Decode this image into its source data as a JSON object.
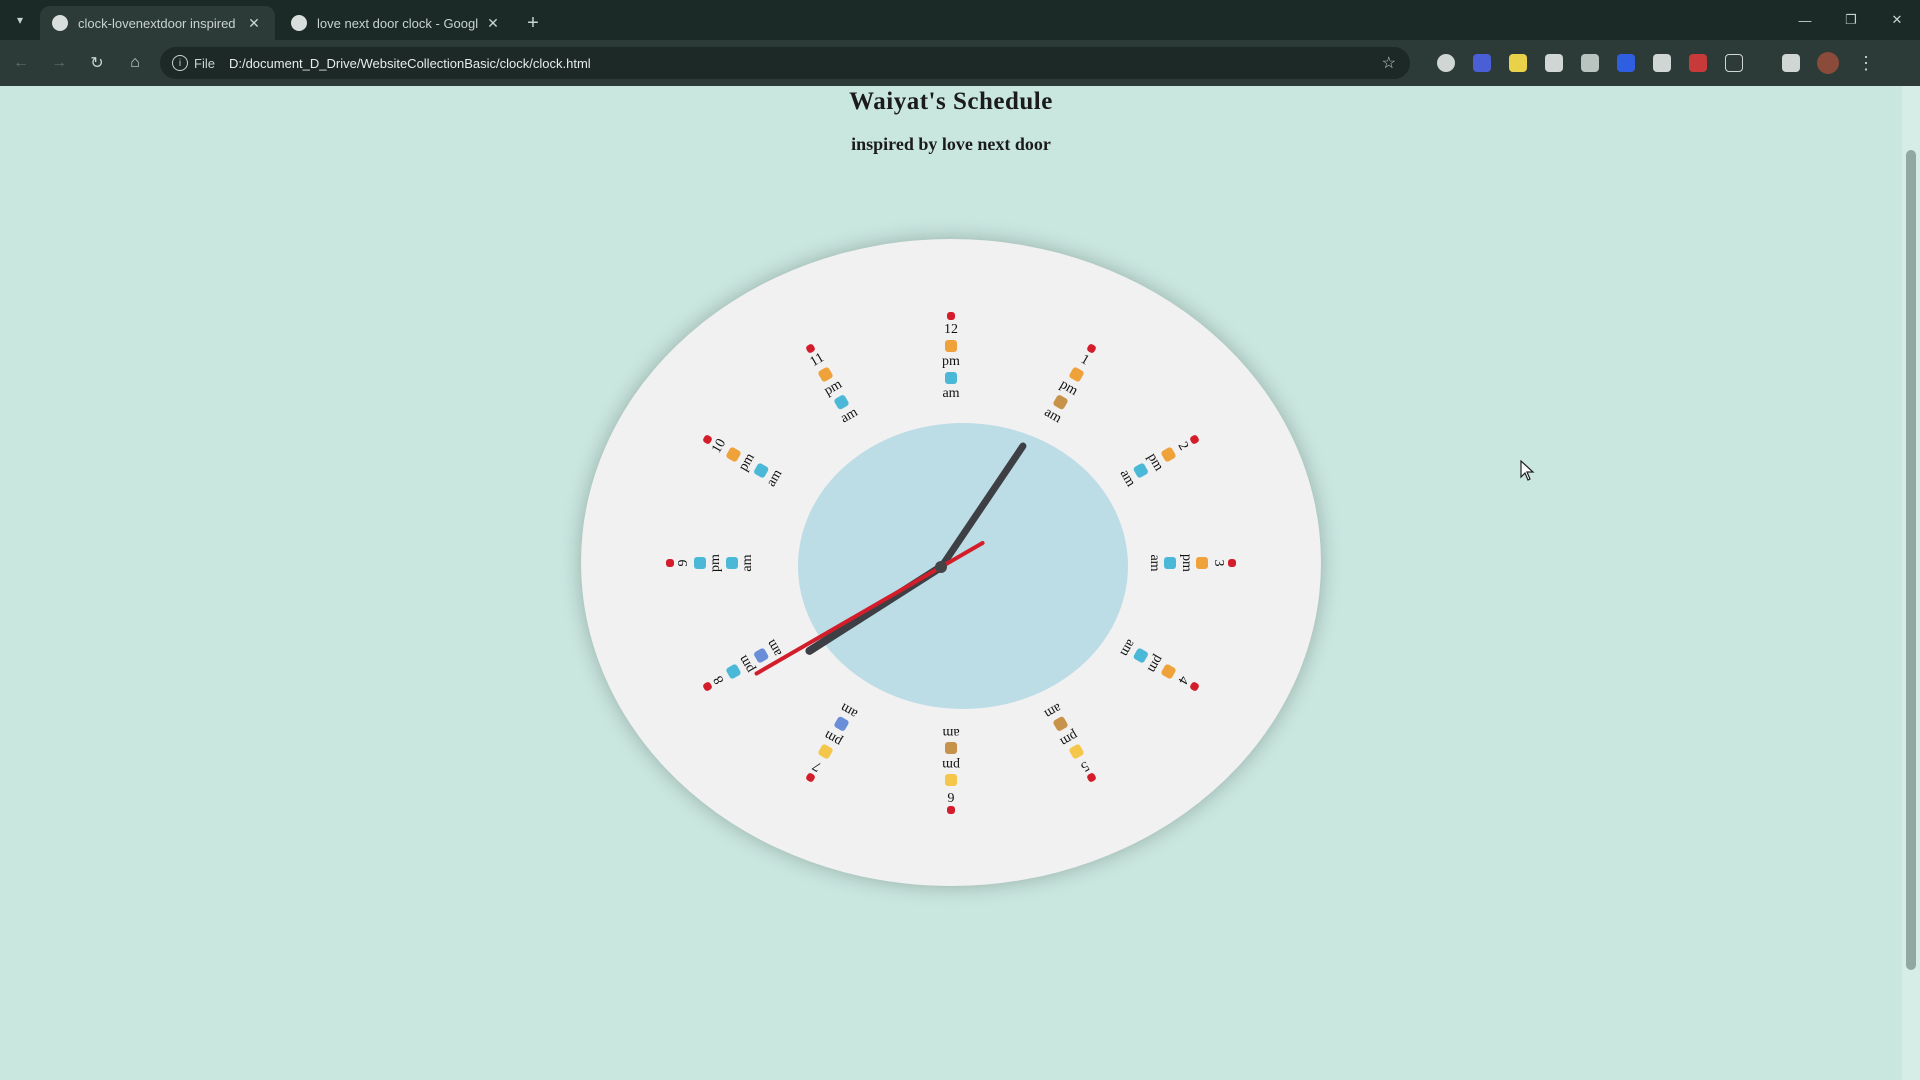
{
  "browser": {
    "tabs": [
      {
        "title": "clock-lovenextdoor inspired",
        "active": true
      },
      {
        "title": "love next door clock - Googl",
        "active": false
      }
    ],
    "new_tab_icon": "+",
    "address": {
      "scheme_label": "File",
      "url": "D:/document_D_Drive/WebsiteCollectionBasic/clock/clock.html"
    }
  },
  "page": {
    "title": "Waiyat's Schedule",
    "subtitle": "inspired by love next door"
  },
  "clock": {
    "hours": [
      {
        "n": "12",
        "pm": "pm",
        "am": "am"
      },
      {
        "n": "1",
        "pm": "pm",
        "am": "am"
      },
      {
        "n": "2",
        "pm": "pm",
        "am": "am"
      },
      {
        "n": "3",
        "pm": "pm",
        "am": "am"
      },
      {
        "n": "4",
        "pm": "pm",
        "am": "am"
      },
      {
        "n": "5",
        "pm": "pm",
        "am": "am"
      },
      {
        "n": "6",
        "pm": "pm",
        "am": "am"
      },
      {
        "n": "7",
        "pm": "pm",
        "am": "am"
      },
      {
        "n": "8",
        "pm": "pm",
        "am": "am"
      },
      {
        "n": "9",
        "pm": "pm",
        "am": "am"
      },
      {
        "n": "10",
        "pm": "pm",
        "am": "am"
      },
      {
        "n": "11",
        "pm": "pm",
        "am": "am"
      }
    ],
    "time": {
      "hour": 8,
      "minute": 5,
      "second": 40
    },
    "colors": {
      "face": "#f1f1f1",
      "inner": "#bcdce6",
      "hour_hand": "#3d3f44",
      "minute_hand": "#3d3f44",
      "second_hand": "#d31d2b",
      "background": "#c9e6df"
    }
  }
}
